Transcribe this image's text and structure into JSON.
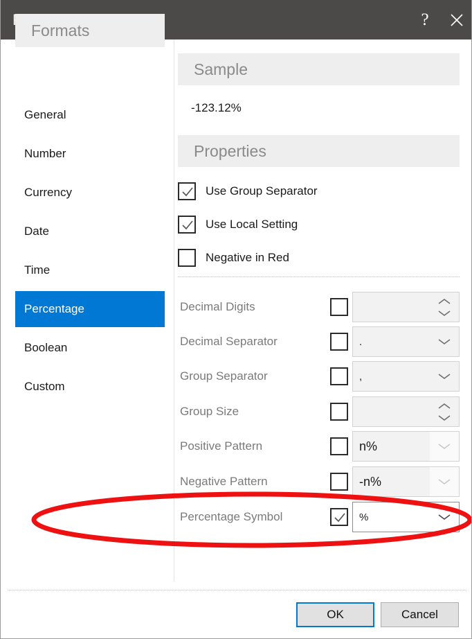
{
  "window": {
    "title": "Format",
    "help_icon": "question-mark-icon",
    "close_icon": "close-icon"
  },
  "sidebar": {
    "header": "Formats",
    "items": [
      {
        "label": "General",
        "selected": false
      },
      {
        "label": "Number",
        "selected": false
      },
      {
        "label": "Currency",
        "selected": false
      },
      {
        "label": "Date",
        "selected": false
      },
      {
        "label": "Time",
        "selected": false
      },
      {
        "label": "Percentage",
        "selected": true
      },
      {
        "label": "Boolean",
        "selected": false
      },
      {
        "label": "Custom",
        "selected": false
      }
    ],
    "selected_color": "#0078d4"
  },
  "sample": {
    "header": "Sample",
    "value": "-123.12%"
  },
  "properties": {
    "header": "Properties",
    "checkboxes": [
      {
        "label": "Use Group Separator",
        "checked": true
      },
      {
        "label": "Use Local Setting",
        "checked": true
      },
      {
        "label": "Negative in Red",
        "checked": false
      }
    ],
    "rows": [
      {
        "label": "Decimal Digits",
        "checked": false,
        "value": "",
        "control": "spinner",
        "enabled": false
      },
      {
        "label": "Decimal Separator",
        "checked": false,
        "value": ".",
        "control": "dropdown",
        "enabled": false
      },
      {
        "label": "Group Separator",
        "checked": false,
        "value": ",",
        "control": "dropdown",
        "enabled": false
      },
      {
        "label": "Group Size",
        "checked": false,
        "value": "",
        "control": "spinner",
        "enabled": false
      },
      {
        "label": "Positive Pattern",
        "checked": false,
        "value": "n%",
        "control": "dropdown",
        "enabled": false
      },
      {
        "label": "Negative Pattern",
        "checked": false,
        "value": "-n%",
        "control": "dropdown",
        "enabled": false
      },
      {
        "label": "Percentage Symbol",
        "checked": true,
        "value": "%",
        "control": "dropdown",
        "enabled": true
      }
    ]
  },
  "footer": {
    "ok_label": "OK",
    "cancel_label": "Cancel"
  },
  "annotation": {
    "shape": "ellipse",
    "color": "#ee1111",
    "target": "Percentage Symbol"
  }
}
